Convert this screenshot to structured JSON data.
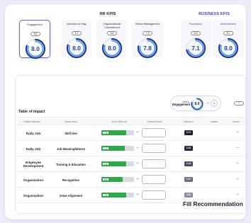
{
  "hr_kpis": {
    "title": "HR KPIS",
    "items": [
      {
        "name": "Engagement",
        "target": "8.0",
        "value": "8.0",
        "progress": 0.8
      },
      {
        "name": "Intention to Stay",
        "target": "8.1",
        "value": "8.0",
        "progress": 0.8
      },
      {
        "name": "Organizational Commitment",
        "target": "8.6",
        "value": "8.0",
        "progress": 0.8
      },
      {
        "name": "Stress Management",
        "target": "7.9",
        "value": "7.8",
        "progress": 0.78
      }
    ]
  },
  "business_kpis": {
    "title": "BUSINESS KPIS",
    "items": [
      {
        "name": "Fluctuation",
        "target": "6.8",
        "value": "7.1",
        "progress": 0.71
      },
      {
        "name": "Absenteeism",
        "target": "8.1",
        "value": "8.0",
        "progress": 0.8
      }
    ]
  },
  "impact": {
    "title": "Table of impact",
    "metric": {
      "label_top": "Metric",
      "label_bottom": "Engagement",
      "value": "8.0",
      "progress": 0.8,
      "arrow": "→",
      "unknown": "?",
      "target_pill": "?"
    },
    "columns": [
      "Health indicator",
      "Action area",
      "Score (Bench)",
      "Desired Score",
      "Influence",
      "Impact",
      "Action"
    ],
    "rows": [
      {
        "indicator": "Daily Job",
        "area": "Skill Use",
        "score": "7.5",
        "score_level": 0.75,
        "influence": "0.17",
        "influence_color": "#1e1e2e"
      },
      {
        "indicator": "Daily Job",
        "area": "Job Meaningfulness",
        "score": "7.2",
        "score_level": 0.72,
        "influence": "0.16",
        "influence_color": "#262636"
      },
      {
        "indicator": "Employee Development",
        "area": "Training & Education",
        "score": "7.6",
        "score_level": 0.76,
        "influence": "0.14",
        "influence_color": "#4a4a5e"
      },
      {
        "indicator": "Organization",
        "area": "Recognition",
        "score": "6.6",
        "score_level": 0.66,
        "influence": "0.07",
        "influence_color": "#6e6e82"
      },
      {
        "indicator": "Organization",
        "area": "Value Alignment",
        "score": "7.6",
        "score_level": 0.76,
        "influence": "0.02",
        "influence_color": "#8a8a9c"
      }
    ],
    "arrow": "→"
  },
  "fill_button": "Fill Recommendation",
  "colors": {
    "accent": "#4a3fd4",
    "gauge_dark": "#1f3b8f",
    "gauge_light": "#3c8ef0",
    "bar_green": "#2ea84a",
    "active_border": "#5a66d6"
  }
}
